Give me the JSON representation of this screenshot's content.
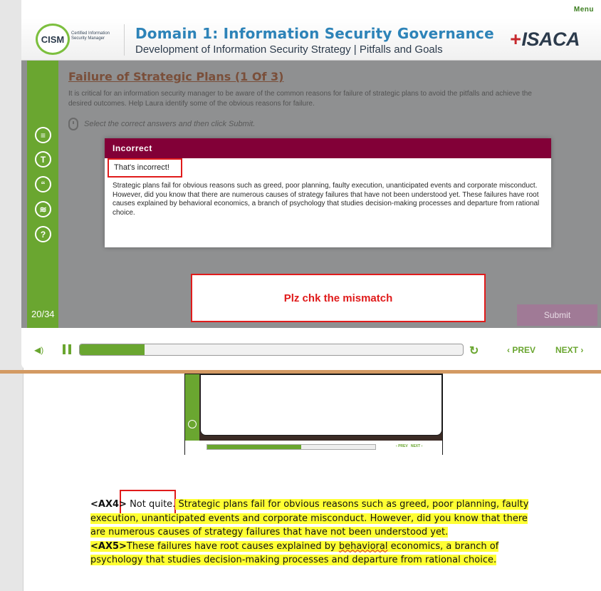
{
  "player": {
    "menu_label": "Menu",
    "header": {
      "logo_text": "CISM",
      "logo_sub": "Certified Information Security Manager",
      "domain_title": "Domain 1: Information Security Governance",
      "domain_subtitle": "Development of Information Security Strategy | Pitfalls and Goals",
      "brand": "ISACA"
    },
    "slide": {
      "title": "Failure of Strategic Plans (1 Of 3)",
      "intro": "It is critical for an information security manager to be aware of the common reasons for failure of strategic plans to avoid the pitfalls and achieve the desired outcomes. Help Laura identify some of the obvious reasons for failure.",
      "instruction": "Select the correct answers and then click Submit."
    },
    "sidebar": {
      "icons": [
        "document-icon",
        "transcript-icon",
        "quote-icon",
        "layers-icon",
        "help-icon"
      ],
      "page_counter": "20/34"
    },
    "feedback": {
      "heading": "Incorrect",
      "short_text": "That's incorrect!",
      "body": "Strategic plans fail for obvious reasons such as greed, poor planning, faulty execution, unanticipated events and corporate misconduct. However, did you know that there are numerous causes of strategy failures that have not been understood yet. These failures have root causes explained by behavioral economics, a branch of psychology that studies decision-making processes and departure from rational choice."
    },
    "review_note": "Plz chk the mismatch",
    "submit_label": "Submit",
    "controls": {
      "progress_fraction": 0.17,
      "prev_label": "PREV",
      "next_label": "NEXT"
    }
  },
  "thumbnail": {
    "prev_label": "PREV",
    "next_label": "NEXT",
    "progress_fraction": 0.56
  },
  "script": {
    "ax4_tag": "<AX4>",
    "ax4_lead": "Not quite.",
    "ax4_text": " Strategic plans fail for obvious reasons such as greed, poor planning, faulty execution, unanticipated events and corporate misconduct. However, did you know that there are numerous causes of strategy failures that have not been understood yet.",
    "ax5_tag": "<AX5>",
    "ax5_text_a": "These failures have root causes explained by ",
    "ax5_squiggle": "behavioral",
    "ax5_text_b": " economics, a branch of psychology that studies decision-making processes and departure from rational choice."
  }
}
